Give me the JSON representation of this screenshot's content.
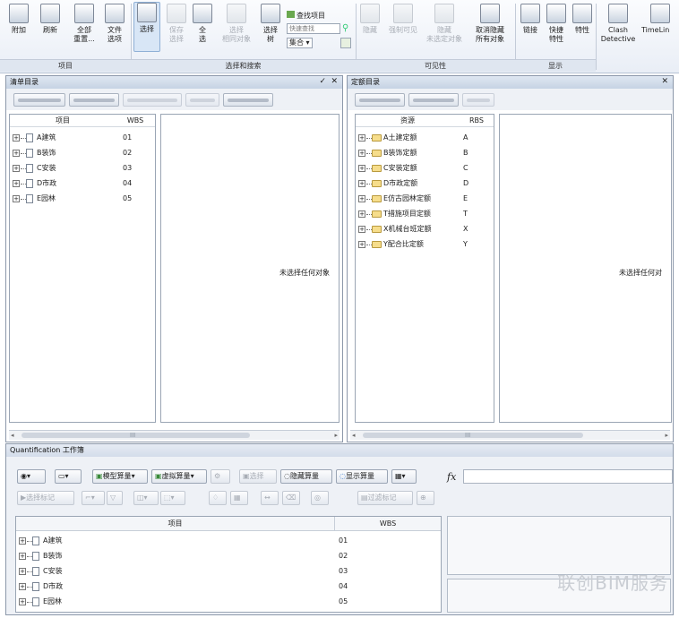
{
  "ribbon": {
    "buttons": [
      {
        "label": "附加",
        "sub": "",
        "disabled": false
      },
      {
        "label": "刷新",
        "sub": "",
        "disabled": false
      },
      {
        "label": "全部",
        "sub": "重置...",
        "disabled": false
      },
      {
        "label": "文件",
        "sub": "选项",
        "disabled": false
      },
      {
        "label": "选择",
        "sub": "",
        "disabled": false
      },
      {
        "label": "保存",
        "sub": "选择",
        "disabled": true
      },
      {
        "label": "全",
        "sub": "选",
        "disabled": false
      },
      {
        "label": "选择",
        "sub": "相同对象",
        "disabled": true
      },
      {
        "label": "选择",
        "sub": "树",
        "disabled": false
      },
      {
        "label": "隐藏",
        "sub": "",
        "disabled": true
      },
      {
        "label": "强制可见",
        "sub": "",
        "disabled": true
      },
      {
        "label": "隐藏",
        "sub": "未选定对象",
        "disabled": true
      },
      {
        "label": "取消隐藏",
        "sub": "所有对象",
        "disabled": false
      },
      {
        "label": "链接",
        "sub": "",
        "disabled": false
      },
      {
        "label": "快捷",
        "sub": "特性",
        "disabled": false
      },
      {
        "label": "特性",
        "sub": "",
        "disabled": false
      },
      {
        "label": "Clash",
        "sub": "Detective",
        "disabled": false
      },
      {
        "label": "TimeLin",
        "sub": "",
        "disabled": false
      }
    ],
    "find_items": "查找项目",
    "quick_find_placeholder": "快速查找",
    "sets_label": "集合",
    "groups": [
      "项目",
      "选择和搜索",
      "可见性",
      "显示"
    ]
  },
  "left_panel": {
    "title": "清单目录",
    "col_item": "项目",
    "col_code": "WBS",
    "rows": [
      {
        "name": "A建筑",
        "code": "01"
      },
      {
        "name": "B装饰",
        "code": "02"
      },
      {
        "name": "C安装",
        "code": "03"
      },
      {
        "name": "D市政",
        "code": "04"
      },
      {
        "name": "E园林",
        "code": "05"
      }
    ],
    "empty_text": "未选择任何对象"
  },
  "right_panel": {
    "title": "定额目录",
    "col_item": "资源",
    "col_code": "RBS",
    "rows": [
      {
        "name": "A土建定额",
        "code": "A"
      },
      {
        "name": "B装饰定额",
        "code": "B"
      },
      {
        "name": "C安装定额",
        "code": "C"
      },
      {
        "name": "D市政定额",
        "code": "D"
      },
      {
        "name": "E仿古园林定额",
        "code": "E"
      },
      {
        "name": "T措施项目定额",
        "code": "T"
      },
      {
        "name": "X机械台班定额",
        "code": "X"
      },
      {
        "name": "Y配合比定额",
        "code": "Y"
      }
    ],
    "empty_text": "未选择任何对"
  },
  "workbook": {
    "title": "Quantification 工作簿",
    "buttons": {
      "model_takeoff": "模型算量",
      "virtual_takeoff": "虚拟算量",
      "select": "选择",
      "hide_takeoff": "隐藏算量",
      "show_takeoff": "显示算量",
      "select_marker": "选择标记",
      "filter_marker": "过滤标记"
    },
    "fx": "fx",
    "col_item": "项目",
    "col_code": "WBS",
    "rows": [
      {
        "name": "A建筑",
        "code": "01"
      },
      {
        "name": "B装饰",
        "code": "02"
      },
      {
        "name": "C安装",
        "code": "03"
      },
      {
        "name": "D市政",
        "code": "04"
      },
      {
        "name": "E园林",
        "code": "05"
      }
    ]
  },
  "scroll_label": "III",
  "watermark": "联创BIM服务"
}
